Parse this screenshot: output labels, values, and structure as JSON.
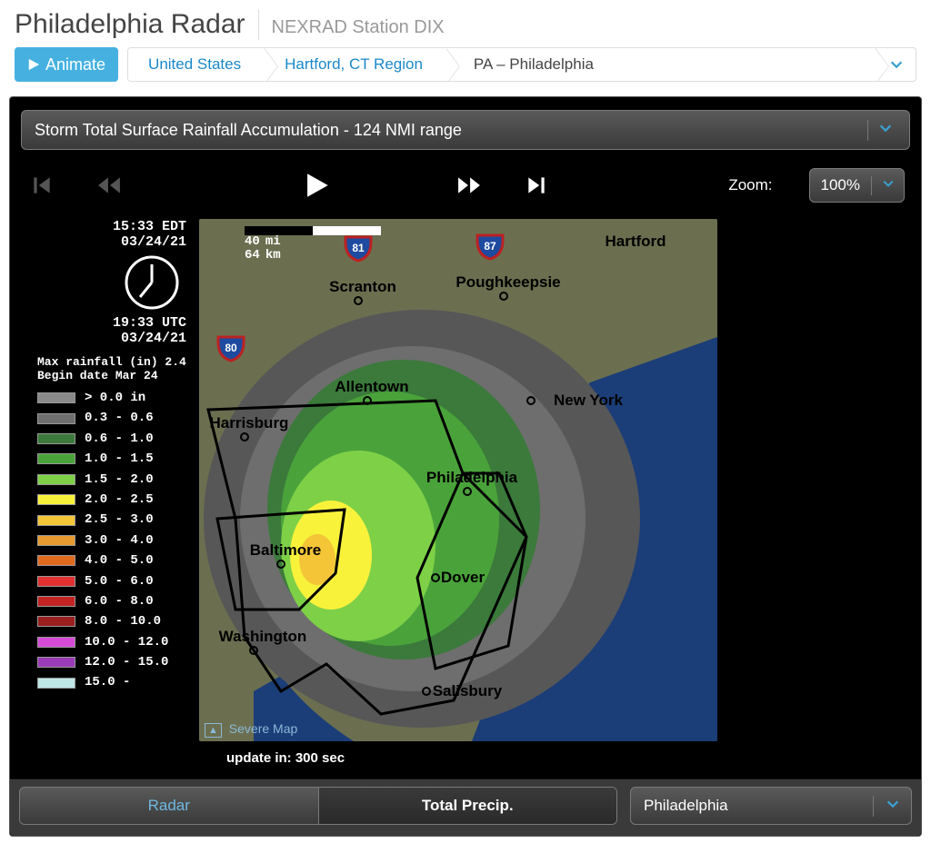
{
  "header": {
    "title": "Philadelphia Radar",
    "subtitle": "NEXRAD Station DIX"
  },
  "toolbar": {
    "animate_label": "Animate",
    "breadcrumb": [
      {
        "label": "United States"
      },
      {
        "label": "Hartford, CT Region"
      },
      {
        "label": "PA – Philadelphia"
      }
    ]
  },
  "product": {
    "selected_label": "Storm Total Surface Rainfall Accumulation - 124 NMI range"
  },
  "zoom": {
    "label": "Zoom:",
    "value": "100%"
  },
  "timestamp": {
    "local": "15:33 EDT",
    "local_date": "03/24/21",
    "utc": "19:33 UTC",
    "utc_date": "03/24/21"
  },
  "max_rainfall": {
    "line1": "Max rainfall (in) 2.4",
    "line2": "Begin date Mar 24"
  },
  "legend": {
    "unit_row": {
      "label": "> 0.0 in",
      "color": "#8a8a8a"
    },
    "rows": [
      {
        "label": "0.3 - 0.6",
        "color": "#6e6e6e"
      },
      {
        "label": "0.6 - 1.0",
        "color": "#3b7a3b"
      },
      {
        "label": "1.0 - 1.5",
        "color": "#4aa33a"
      },
      {
        "label": "1.5 - 2.0",
        "color": "#7ed047"
      },
      {
        "label": "2.0 - 2.5",
        "color": "#f9f23b"
      },
      {
        "label": "2.5 - 3.0",
        "color": "#f4c537"
      },
      {
        "label": "3.0 - 4.0",
        "color": "#e79a2f"
      },
      {
        "label": "4.0 - 5.0",
        "color": "#e06a1e"
      },
      {
        "label": "5.0 - 6.0",
        "color": "#e23030"
      },
      {
        "label": "6.0 - 8.0",
        "color": "#c22222"
      },
      {
        "label": "8.0 - 10.0",
        "color": "#9b1f1f"
      },
      {
        "label": "10.0 - 12.0",
        "color": "#d64bd6"
      },
      {
        "label": "12.0 - 15.0",
        "color": "#9b3bb7"
      },
      {
        "label": "15.0 -",
        "color": "#bfe6e6"
      }
    ]
  },
  "scale": {
    "miles": "40",
    "mi_unit": "mi",
    "km": "64",
    "km_unit": "km"
  },
  "map": {
    "cities": [
      "Scranton",
      "Allentown",
      "Harrisburg",
      "Philadelphia",
      "Baltimore",
      "Washington",
      "Dover",
      "Salisbury",
      "New York",
      "Poughkeepsie",
      "Hartford"
    ],
    "highways": [
      "81",
      "80",
      "87"
    ],
    "attrib_text": "Severe Map"
  },
  "update": {
    "text": "update in: 300 sec"
  },
  "tabs": {
    "items": [
      {
        "label": "Radar",
        "active": false
      },
      {
        "label": "Total Precip.",
        "active": true
      }
    ]
  },
  "station_select": {
    "label": "Philadelphia"
  }
}
